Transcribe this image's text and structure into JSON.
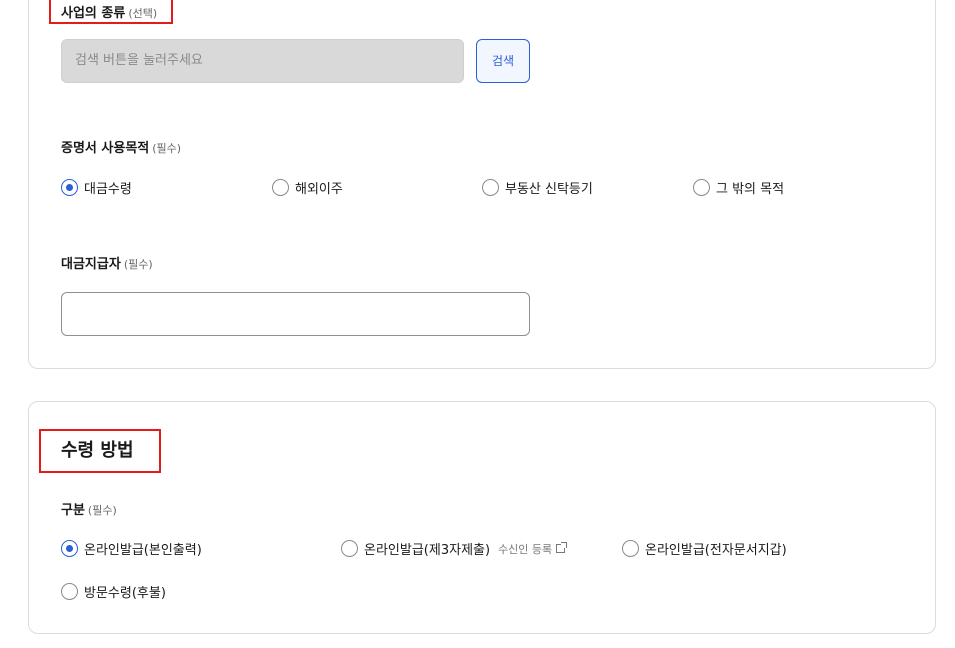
{
  "business_type": {
    "label": "사업의 종류",
    "optional": "(선택)",
    "search_placeholder": "검색 버튼을 눌러주세요",
    "search_button": "검색"
  },
  "purpose": {
    "label": "증명서 사용목적",
    "required": "(필수)",
    "options": [
      {
        "label": "대금수령",
        "checked": true
      },
      {
        "label": "해외이주",
        "checked": false
      },
      {
        "label": "부동산 신탁등기",
        "checked": false
      },
      {
        "label": "그 밖의 목적",
        "checked": false
      }
    ]
  },
  "payer": {
    "label": "대금지급자",
    "required": "(필수)",
    "value": ""
  },
  "receipt": {
    "title": "수령 방법",
    "category_label": "구분",
    "required": "(필수)",
    "options": [
      {
        "label": "온라인발급(본인출력)",
        "checked": true
      },
      {
        "label": "온라인발급(제3자제출)",
        "checked": false,
        "hint": "수신인 등록"
      },
      {
        "label": "온라인발급(전자문서지갑)",
        "checked": false
      },
      {
        "label": "방문수령(후불)",
        "checked": false
      }
    ]
  },
  "colors": {
    "accent": "#2b5fd8",
    "highlight": "#e31b1b"
  }
}
